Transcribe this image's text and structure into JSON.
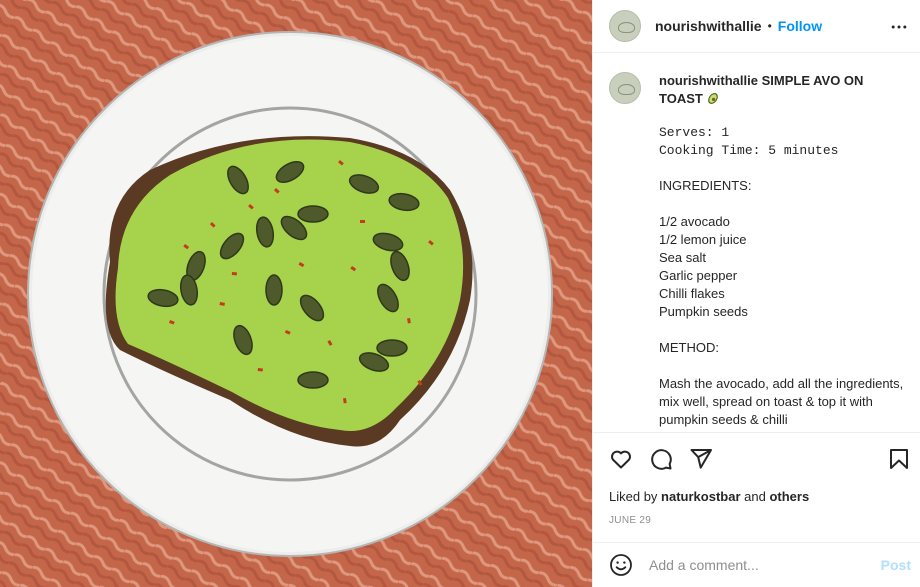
{
  "image": {
    "alt": "",
    "colors": {
      "rug": "#c4664a",
      "plate": "#f4f4f2",
      "plate_rim": "#a9a9a9",
      "toast": "#5a3a22",
      "avocado": "#a5d14a",
      "seeds": "#4e5a2c"
    }
  },
  "header": {
    "username": "nourishwithallie",
    "separator": "•",
    "follow_label": "Follow",
    "more_icon": "more-horizontal-icon"
  },
  "caption": {
    "username": "nourishwithallie",
    "title": "SIMPLE AVO ON TOAST",
    "title_emoji": "avocado-emoji",
    "serves": "Serves: 1",
    "cooking_time": "Cooking Time: 5 minutes",
    "body": "INGREDIENTS:\n\n1/2 avocado\n1/2 lemon juice\nSea salt\nGarlic pepper\nChilli flakes\nPumpkin seeds\n\nMETHOD:\n\nMash the avocado, add all the ingredients, mix well, spread on toast & top it with pumpkin seeds & chilli"
  },
  "actions": {
    "icons": [
      "heart-icon",
      "comment-icon",
      "share-icon",
      "bookmark-icon"
    ],
    "liked_by_prefix": "Liked by",
    "liked_by_user": "naturkostbar",
    "liked_by_and": "and",
    "liked_by_others": "others",
    "date": "JUNE 29"
  },
  "comment_box": {
    "placeholder": "Add a comment...",
    "post_label": "Post",
    "emoji_icon": "smiley-icon"
  }
}
